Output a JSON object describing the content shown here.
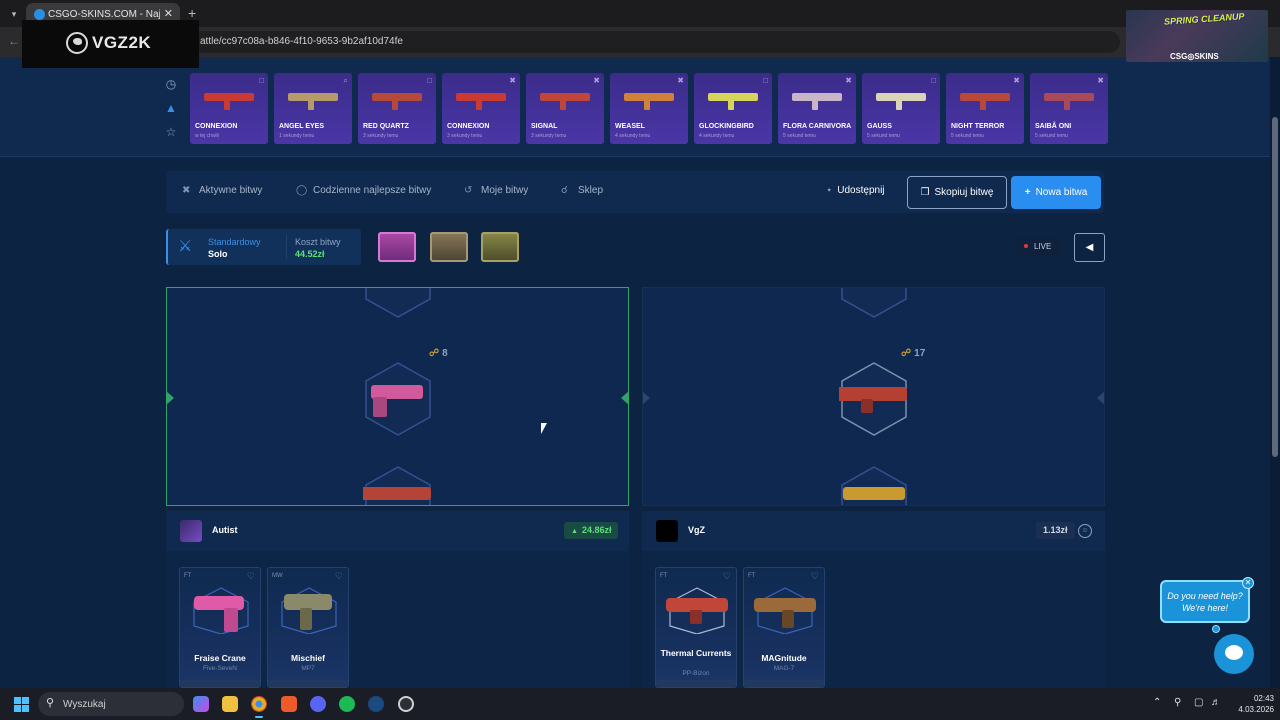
{
  "browser": {
    "tab_title": "CSGO-SKINS.COM - Najlepsze",
    "url": "attle/cc97c08a-b846-4f10-9653-9b2af10d74fe"
  },
  "overlays": {
    "vgz_text": "VGZ2K",
    "spring_text": "SPRING CLEANUP",
    "stream_logo": "CSG◎SKINS"
  },
  "live_drops": [
    {
      "name": "CONNEXION",
      "time": "w tej chwili",
      "icon": "box",
      "color": "#c83a32"
    },
    {
      "name": "ANGEL EYES",
      "time": "1 sekundy temu",
      "icon": "search",
      "color": "#b79a6a"
    },
    {
      "name": "RED QUARTZ",
      "time": "3 sekundy temu",
      "icon": "box",
      "color": "#b54a3a"
    },
    {
      "name": "CONNEXION",
      "time": "3 sekundy temu",
      "icon": "crossed",
      "color": "#c83a32"
    },
    {
      "name": "SIGNAL",
      "time": "3 sekundy temu",
      "icon": "crossed",
      "color": "#c0463a"
    },
    {
      "name": "WEASEL",
      "time": "4 sekundy temu",
      "icon": "crossed",
      "color": "#d0823a"
    },
    {
      "name": "GLOCKINGBIRD",
      "time": "4 sekundy temu",
      "icon": "box",
      "color": "#d6d45a"
    },
    {
      "name": "FLORA CARNIVORA",
      "time": "5 sekund temu",
      "icon": "crossed",
      "color": "#c8b6c8"
    },
    {
      "name": "GAUSS",
      "time": "5 sekund temu",
      "icon": "box",
      "color": "#d9d3b8"
    },
    {
      "name": "NIGHT TERROR",
      "time": "5 sekund temu",
      "icon": "crossed",
      "color": "#b8483a"
    },
    {
      "name": "SAIBĂ ONI",
      "time": "5 sekund temu",
      "icon": "crossed",
      "color": "#a84a5a"
    }
  ],
  "nav": {
    "active_battles": "Aktywne bitwy",
    "daily_best": "Codzienne najlepsze bitwy",
    "my_battles": "Moje bitwy",
    "shop": "Sklep",
    "share": "Udostępnij",
    "copy_battle": "Skopiuj bitwę",
    "new_battle": "Nowa bitwa"
  },
  "battle_info": {
    "mode_label": "Standardowy",
    "mode_value": "Solo",
    "cost_label": "Koszt bitwy",
    "cost_value": "44.52zł",
    "live_label": "LIVE"
  },
  "arenas": [
    {
      "count": "8"
    },
    {
      "count": "17"
    }
  ],
  "players": [
    {
      "name": "Autist",
      "total": "24.86zł",
      "items": [
        {
          "wear": "FT",
          "name": "Fraise Crane",
          "weapon": "Five-SeveN",
          "color": "#e05aa8"
        },
        {
          "wear": "MW",
          "name": "Mischief",
          "weapon": "MP7",
          "color": "#8a8a6a"
        }
      ]
    },
    {
      "name": "VgZ",
      "total": "1.13zł",
      "items": [
        {
          "wear": "FT",
          "name": "Thermal Currents",
          "weapon": "PP-Bizon",
          "color": "#c0463a"
        },
        {
          "wear": "FT",
          "name": "MAGnitude",
          "weapon": "MAG-7",
          "color": "#9a6a3a"
        }
      ]
    }
  ],
  "help": {
    "bubble_text": "Do you need help? We're here!"
  },
  "taskbar": {
    "search_placeholder": "Wyszukaj",
    "time": "02:43",
    "date": "4.03.2026"
  }
}
